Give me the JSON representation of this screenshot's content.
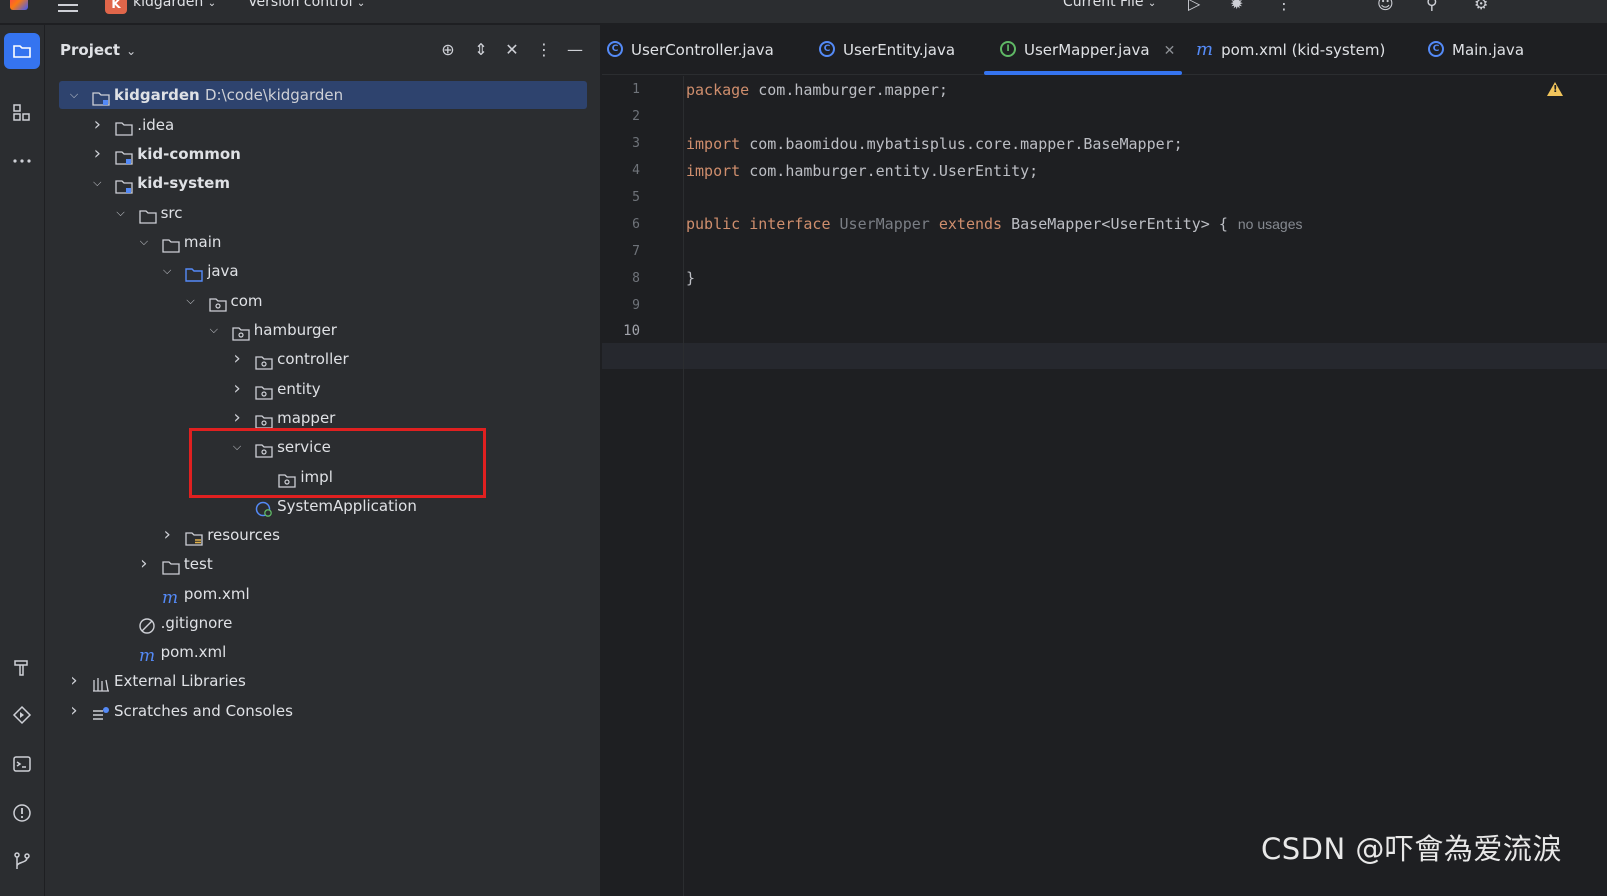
{
  "topbar": {
    "project_badge": "K",
    "project_name": "kidgarden",
    "vcs_label": "Version control",
    "run_config": "Current File"
  },
  "project_panel": {
    "title": "Project",
    "tree": [
      {
        "label": "kidgarden",
        "path": "D:\\code\\kidgarden",
        "bold": true,
        "expanded": true,
        "icon": "module-folder-icon"
      },
      {
        "label": ".idea",
        "expanded": false,
        "icon": "folder-icon"
      },
      {
        "label": "kid-common",
        "bold": true,
        "expanded": false,
        "icon": "module-folder-icon"
      },
      {
        "label": "kid-system",
        "bold": true,
        "expanded": true,
        "icon": "module-folder-icon"
      },
      {
        "label": "src",
        "expanded": true,
        "icon": "folder-icon"
      },
      {
        "label": "main",
        "expanded": true,
        "icon": "folder-icon"
      },
      {
        "label": "java",
        "expanded": true,
        "icon": "source-folder-icon"
      },
      {
        "label": "com",
        "expanded": true,
        "icon": "package-icon"
      },
      {
        "label": "hamburger",
        "expanded": true,
        "icon": "package-icon"
      },
      {
        "label": "controller",
        "expanded": false,
        "icon": "package-icon"
      },
      {
        "label": "entity",
        "expanded": false,
        "icon": "package-icon"
      },
      {
        "label": "mapper",
        "expanded": false,
        "icon": "package-icon"
      },
      {
        "label": "service",
        "expanded": true,
        "icon": "package-icon"
      },
      {
        "label": "impl",
        "icon": "package-icon"
      },
      {
        "label": "SystemApplication",
        "icon": "spring-class-icon"
      },
      {
        "label": "resources",
        "expanded": false,
        "icon": "resources-folder-icon"
      },
      {
        "label": "test",
        "expanded": false,
        "icon": "folder-icon"
      },
      {
        "label": "pom.xml",
        "icon": "maven-icon"
      },
      {
        "label": ".gitignore",
        "icon": "ignore-file-icon"
      },
      {
        "label": "pom.xml",
        "icon": "maven-icon"
      },
      {
        "label": "External Libraries",
        "expanded": false,
        "icon": "libraries-icon"
      },
      {
        "label": "Scratches and Consoles",
        "expanded": false,
        "icon": "scratches-icon"
      }
    ]
  },
  "tabs": [
    {
      "label": "UserController.java",
      "icon": "class-icon"
    },
    {
      "label": "UserEntity.java",
      "icon": "class-icon"
    },
    {
      "label": "UserMapper.java",
      "icon": "interface-icon",
      "active": true
    },
    {
      "label": "pom.xml (kid-system)",
      "icon": "maven-icon"
    },
    {
      "label": "Main.java",
      "icon": "class-icon"
    }
  ],
  "editor": {
    "line_numbers": [
      "1",
      "2",
      "3",
      "4",
      "5",
      "6",
      "7",
      "8",
      "9",
      "10"
    ],
    "current_line": "10",
    "code": {
      "l1_kw": "package",
      "l1_rest": " com.hamburger.mapper;",
      "l3_kw": "import",
      "l3_rest": " com.baomidou.mybatisplus.core.mapper.BaseMapper;",
      "l4_kw": "import",
      "l4_rest": " com.hamburger.entity.UserEntity;",
      "l6_kw1": "public interface",
      "l6_name": " UserMapper ",
      "l6_kw2": "extends",
      "l6_rest": " BaseMapper<UserEntity> {",
      "l6_hint": "no usages",
      "l8": "}"
    }
  },
  "watermark": "CSDN @吓會為爱流淚",
  "colors": {
    "accent": "#3574f0",
    "highlight_box": "#e02020",
    "keyword": "#cf8e6d"
  }
}
